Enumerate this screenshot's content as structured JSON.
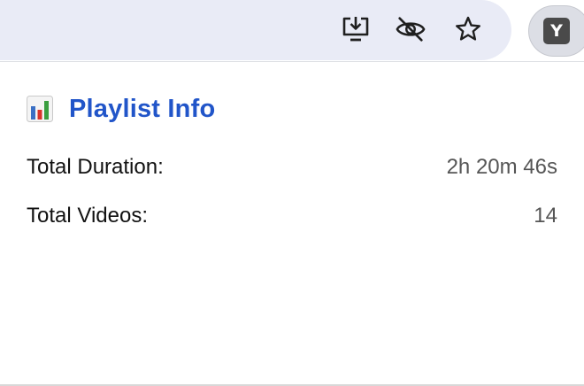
{
  "browser": {
    "toolbar_icons": [
      "install-app-icon",
      "eye-off-icon",
      "bookmark-star-icon"
    ],
    "extension_badge": "Y"
  },
  "popup": {
    "icon": "bar-chart-icon",
    "title": "Playlist Info",
    "title_color": "#2155c9",
    "stats": {
      "duration_label": "Total Duration:",
      "duration_value": "2h 20m 46s",
      "videos_label": "Total Videos:",
      "videos_value": "14"
    }
  }
}
